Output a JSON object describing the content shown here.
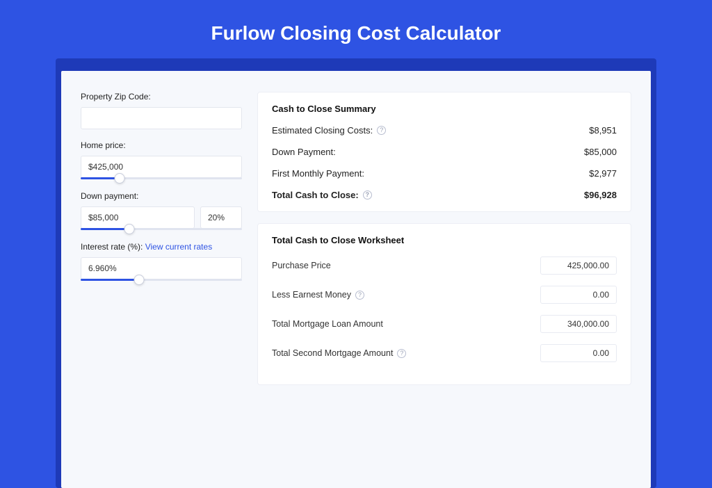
{
  "page_title": "Furlow Closing Cost Calculator",
  "left": {
    "zip_label": "Property Zip Code:",
    "zip_value": "",
    "home_price_label": "Home price:",
    "home_price_value": "$425,000",
    "home_price_slider_pct": 24,
    "down_payment_label": "Down payment:",
    "down_payment_value": "$85,000",
    "down_payment_pct": "20%",
    "down_payment_slider_pct": 30,
    "interest_label": "Interest rate (%): ",
    "interest_link": "View current rates",
    "interest_value": "6.960%",
    "interest_slider_pct": 36
  },
  "summary": {
    "title": "Cash to Close Summary",
    "rows": [
      {
        "label": "Estimated Closing Costs:",
        "help": true,
        "value": "$8,951",
        "bold": false
      },
      {
        "label": "Down Payment:",
        "help": false,
        "value": "$85,000",
        "bold": false
      },
      {
        "label": "First Monthly Payment:",
        "help": false,
        "value": "$2,977",
        "bold": false
      },
      {
        "label": "Total Cash to Close:",
        "help": true,
        "value": "$96,928",
        "bold": true
      }
    ]
  },
  "worksheet": {
    "title": "Total Cash to Close Worksheet",
    "rows": [
      {
        "label": "Purchase Price",
        "help": false,
        "value": "425,000.00"
      },
      {
        "label": "Less Earnest Money",
        "help": true,
        "value": "0.00"
      },
      {
        "label": "Total Mortgage Loan Amount",
        "help": false,
        "value": "340,000.00"
      },
      {
        "label": "Total Second Mortgage Amount",
        "help": true,
        "value": "0.00"
      }
    ]
  }
}
